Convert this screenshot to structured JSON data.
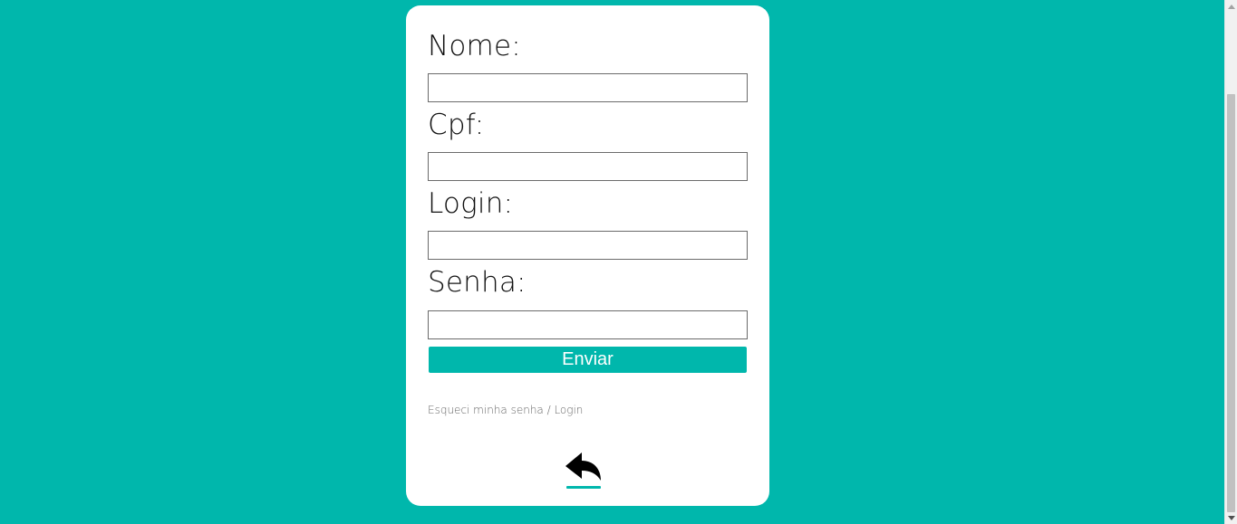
{
  "page": {
    "background_color": "#00b7ac"
  },
  "form": {
    "nome_label": "Nome:",
    "cpf_label": "Cpf:",
    "login_label": "Login:",
    "senha_label": "Senha:",
    "nome_value": "",
    "cpf_value": "",
    "login_value": "",
    "senha_value": "",
    "submit_label": "Enviar",
    "forgot_link": "Esqueci minha senha / Login",
    "back_icon": "reply-arrow-icon"
  },
  "colors": {
    "accent": "#00b7ac",
    "card": "#ffffff",
    "text": "#111111",
    "link": "#666666"
  }
}
